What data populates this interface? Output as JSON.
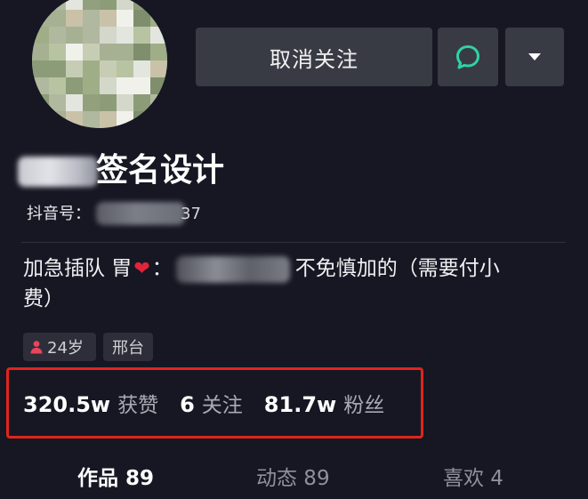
{
  "profile": {
    "name_suffix": "签名设计",
    "id_label": "抖音号：",
    "id_tail": "37"
  },
  "actions": {
    "unfollow_label": "取消关注",
    "message_icon": "chat-bubble-icon",
    "more_icon": "caret-down-icon"
  },
  "bio": {
    "line1_part1": "加急插队 胃",
    "heart": "❤",
    "colon": "：",
    "line1_part2": "不免慎加的（需要付小",
    "line2": "费）"
  },
  "tags": {
    "age_icon": "person-icon",
    "age": "24岁",
    "city": "邢台"
  },
  "stats": {
    "likes_value": "320.5w",
    "likes_label": "获赞",
    "following_value": "6",
    "following_label": "关注",
    "followers_value": "81.7w",
    "followers_label": "粉丝"
  },
  "tabs": {
    "works": "作品 89",
    "updates": "动态 89",
    "likes": "喜欢 4"
  },
  "colors": {
    "background": "#161723",
    "button": "#393b44",
    "accent_green": "#2fd1a5",
    "highlight_red": "#e0251c",
    "heart_red": "#e0243a"
  }
}
